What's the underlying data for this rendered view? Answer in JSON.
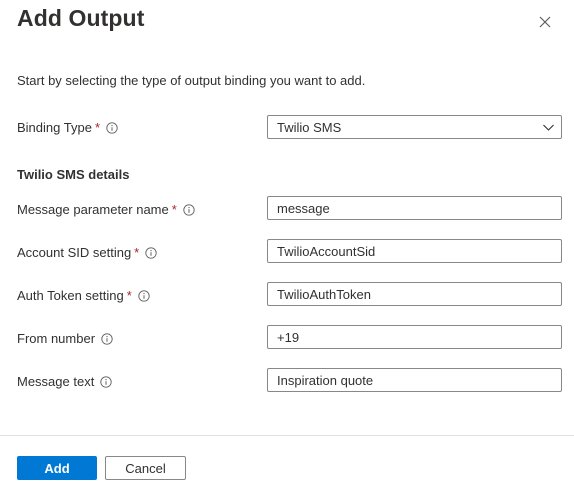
{
  "header": {
    "title": "Add Output",
    "close_icon": "close-icon"
  },
  "intro_text": "Start by selecting the type of output binding you want to add.",
  "binding_type": {
    "label": "Binding Type",
    "required_marker": "*",
    "selected_value": "Twilio SMS"
  },
  "section": {
    "heading": "Twilio SMS details"
  },
  "fields": [
    {
      "label": "Message parameter name",
      "required_marker": "*",
      "value": "message"
    },
    {
      "label": "Account SID setting",
      "required_marker": "*",
      "value": "TwilioAccountSid"
    },
    {
      "label": "Auth Token setting",
      "required_marker": "*",
      "value": "TwilioAuthToken"
    },
    {
      "label": "From number",
      "required_marker": "",
      "value": "+19"
    },
    {
      "label": "Message text",
      "required_marker": "",
      "value": "Inspiration quote"
    }
  ],
  "footer": {
    "add_label": "Add",
    "cancel_label": "Cancel"
  },
  "colors": {
    "primary": "#0078d4",
    "required": "#a4262c",
    "text": "#323130",
    "border": "#8a8886",
    "divider": "#e1dfdd"
  }
}
